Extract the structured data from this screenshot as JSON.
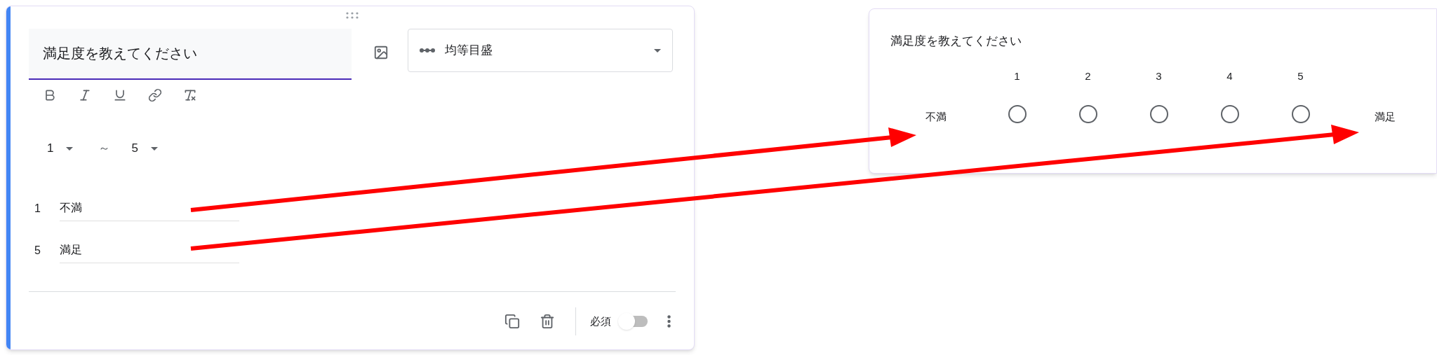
{
  "editor": {
    "question": "満足度を教えてください",
    "type_select": "均等目盛",
    "range": {
      "from": "1",
      "separator": "～",
      "to": "5"
    },
    "labels": [
      {
        "number": "1",
        "value": "不満"
      },
      {
        "number": "5",
        "value": "満足"
      }
    ],
    "required": {
      "label": "必須",
      "on": false
    }
  },
  "preview": {
    "question": "満足度を教えてください",
    "low_label": "不満",
    "high_label": "満足",
    "options": [
      {
        "label": "1",
        "selected": false
      },
      {
        "label": "2",
        "selected": false
      },
      {
        "label": "3",
        "selected": false
      },
      {
        "label": "4",
        "selected": false
      },
      {
        "label": "5",
        "selected": false
      }
    ]
  }
}
